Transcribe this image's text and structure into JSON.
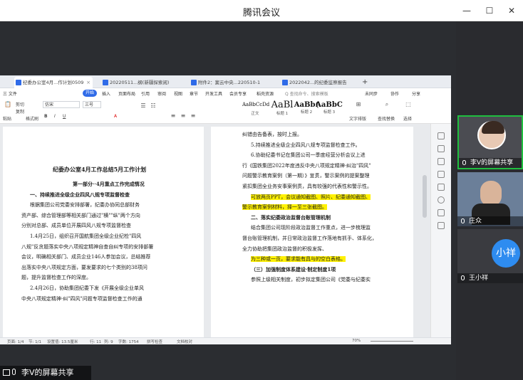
{
  "app_title": "腾讯会议",
  "window_controls": {
    "minimize": "—",
    "maximize": "☐",
    "close": "✕"
  },
  "tabs": [
    {
      "label": "纪委办公室4月...作计划0509",
      "active": true
    },
    {
      "label": "20220511...纲(新疆探索阅)",
      "active": false
    },
    {
      "label": "附件2：案云中央...220510-1",
      "active": false
    },
    {
      "label": "2022042...的纪委监察报告",
      "active": false
    }
  ],
  "new_tab": "+",
  "menu": {
    "file": "三 文件",
    "start": "开始",
    "items": [
      "插入",
      "页面布局",
      "引用",
      "审阅",
      "视图",
      "章节",
      "开发工具",
      "会员专享",
      "稻壳资源"
    ],
    "search": "Q 查找命令、搜索模板",
    "right": [
      "未同步",
      "协作",
      "分享"
    ]
  },
  "toolbar": {
    "paste": "粘贴",
    "cut": "剪切",
    "copy": "复制",
    "format_painter": "格式刷",
    "font": "仿宋",
    "font_size": "三号",
    "styles": [
      {
        "preview": "AaBbCcDd",
        "name": "正文"
      },
      {
        "preview": "AaBl",
        "name": "标题 1"
      },
      {
        "preview": "AaBb(",
        "name": "标题 2"
      },
      {
        "preview": "AaBbC",
        "name": "标题 3"
      }
    ],
    "text_layout": "文字排版",
    "find_replace": "查找替换",
    "select": "选择"
  },
  "left_page": {
    "lines": [
      "纪委办公室4月工作总结5月工作计划",
      "第一部分··4月重点工作完成情况",
      "一、持续推进全级企业四风八规专项监督检查",
      "根据集团公司党委安排部署，纪委办协同总部财务",
      "资产部、综合管理部等相关部门通过\"横\"\"纵\"两个方向",
      "分别对总部、成员单位开展四风八规专项监督检查",
      "1.4月25日，组织召开国航集团全级企业纪检\"四风",
      "八规\"反贪题落实中央八项规定精神自查自纠专项的安排部署",
      "会议，明确相关部门、成员企业146人参加会议，总结推荐",
      "出落实中央八项规定方面，要发要求的七个类别的38项问",
      "题，提升监督检查工作的深度。",
      "2.4月26日，协助集团纪委下发《开展全级企业单风",
      "中央八项规定精神·纠\"四风\"问题专项监督检查工作的通"
    ]
  },
  "right_page": {
    "lines": [
      "纠错由告备表，按时上报。",
      "5.持续推进全级企业四风八规专项监督检查工作。",
      "6.协助纪委书记在集团公司一季度经营分析会议上进",
      "行《国铁集团2022年度违反中央八项规定精神·纠治\"四风\"",
      "问题警示教育案例（第一期）》宣贯，警示案例的提案整理",
      "紧扣集团全业务安事案例贯，具有较强的代表性和警示性。",
      "可放两页PPT，会议通知截图、照片、纪委通知截图、",
      "警示教育案例材料，择一至三张截图。",
      "二、落实纪委政治监督台账管理机制",
      "结合集团公司现阶段政治监督工作重点，进一步梳理监",
      "督台账管理机制，并日常政治监督工作落地有抓手、体系化，",
      "全力协助把集团政治监督的积极发挥、",
      "为三种或一页，要求能有具与的空白表格。",
      "（三）加强制度体系建设·制定制度1项",
      "参照上级相关制度，初步拟定集团公司《党委与纪委实"
    ]
  },
  "statusbar": {
    "page": "页面: 1/4",
    "section": "节: 1/1",
    "setting": "设置值: 13.5厘米",
    "row": "行: 11",
    "col": "列: 9",
    "words": "字数: 1754",
    "spell": "拼写检查",
    "proof": "文档校对",
    "zoom": "70%"
  },
  "participants": [
    {
      "name": "李V的屏幕共享",
      "kind": "photo",
      "speaking": true
    },
    {
      "name": "庄众",
      "kind": "photo",
      "speaking": false
    },
    {
      "name": "王小祥",
      "kind": "avatar",
      "avatar_text": "小祥",
      "speaking": false
    }
  ],
  "share_label": "李V的屏幕共享",
  "colors": {
    "highlight": "#fff100",
    "accent": "#2f6be8",
    "speaking": "#1fbf3f",
    "avatar_blue": "#2e8cf0"
  }
}
